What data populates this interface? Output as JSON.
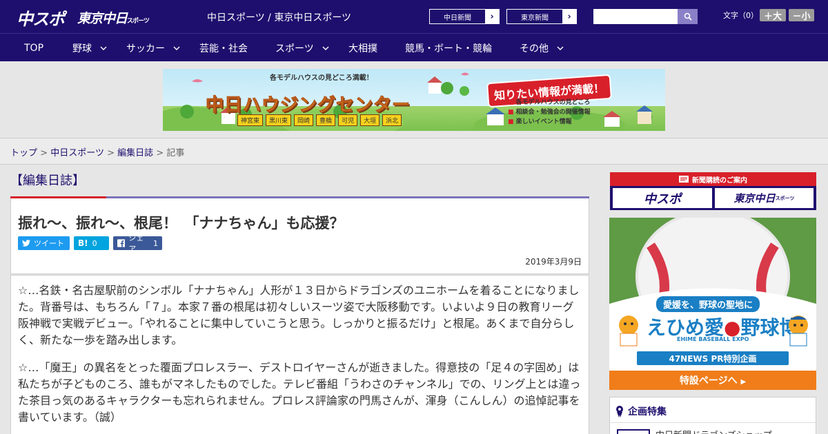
{
  "header": {
    "logo_chuspo": "中スポ",
    "logo_tokyo": "東京中日",
    "logo_tokyo_sub": "スポーツ",
    "site_title": "中日スポーツ / 東京中日スポーツ",
    "btn_chunichi": "中日新聞",
    "btn_tokyo": "東京新聞",
    "search_placeholder": "",
    "font_size_label": "文字（0）",
    "font_bigger": "＋大",
    "font_smaller": "－小"
  },
  "nav": {
    "items": [
      {
        "label": "TOP"
      },
      {
        "label": "野球"
      },
      {
        "label": "サッカー"
      },
      {
        "label": "芸能・社会"
      },
      {
        "label": "スポーツ"
      },
      {
        "label": "大相撲"
      },
      {
        "label": "競馬・ボート・競輪"
      },
      {
        "label": "その他"
      }
    ]
  },
  "banner": {
    "top_text": "各モデルハウスの見どころ満載！",
    "title": "中日ハウジングセンター",
    "badge": "知りたい情報が満載！",
    "locations": [
      "神宮東",
      "黒川東",
      "岡崎",
      "豊橋",
      "可児",
      "大垣",
      "浜北"
    ],
    "bullets": [
      "各モデルハウスの見どころ",
      "相談会・勉強会の開催情報",
      "楽しいイベント情報"
    ]
  },
  "breadcrumb": {
    "top": "トップ",
    "site": "中日スポーツ",
    "section": "編集日誌",
    "current": "記事",
    "sep": ">"
  },
  "article": {
    "section_title": "【編集日誌】",
    "title": "振れ～、振れ～、根尾！　「ナナちゃん」も応援？",
    "tweet_label": "ツイート",
    "hatena_count": "0",
    "share_label": "シェア",
    "share_count": "1",
    "date": "2019年3月9日",
    "paragraphs": [
      "☆…名鉄・名古屋駅前のシンボル「ナナちゃん」人形が１３日からドラゴンズのユニホームを着ることになりました。背番号は、もちろん「７」。本家７番の根尾は初々しいスーツ姿で大阪移動です。いよいよ９日の教育リーグ阪神戦で実戦デビュー。「やれることに集中していこうと思う。しっかりと振るだけ」と根尾。あくまで自分らしく、新たな一歩を踏み出します。",
      "☆…「魔王」の異名をとった覆面プロレスラー、デストロイヤーさんが逝きました。得意技の「足４の字固め」は私たちが子どものころ、誰もがマネしたものでした。テレビ番組「うわさのチャンネル」での、リング上とは違った茶目っ気のあるキャラクターも忘れられません。プロレス評論家の門馬さんが、渾身（こんしん）の追悼記事を書いています。（誠）"
    ]
  },
  "sidebar": {
    "subscription_title": "新聞購読のご案内",
    "sub_chuspo": "中スポ",
    "sub_tokyo": "東京中日",
    "sub_tokyo_small": "スポーツ",
    "ad_tagline": "愛媛を、野球の聖地に",
    "ad_title": "えひめ愛",
    "ad_title2": "野球博",
    "ad_sub": "EHIME BASEBALL EXPO",
    "ad_pr": "47NEWS PR特別企画",
    "ad_cta": "特設ページへ",
    "feature_title": "企画特集",
    "feature_item": "中日新聞ドラゴンズショップ"
  }
}
